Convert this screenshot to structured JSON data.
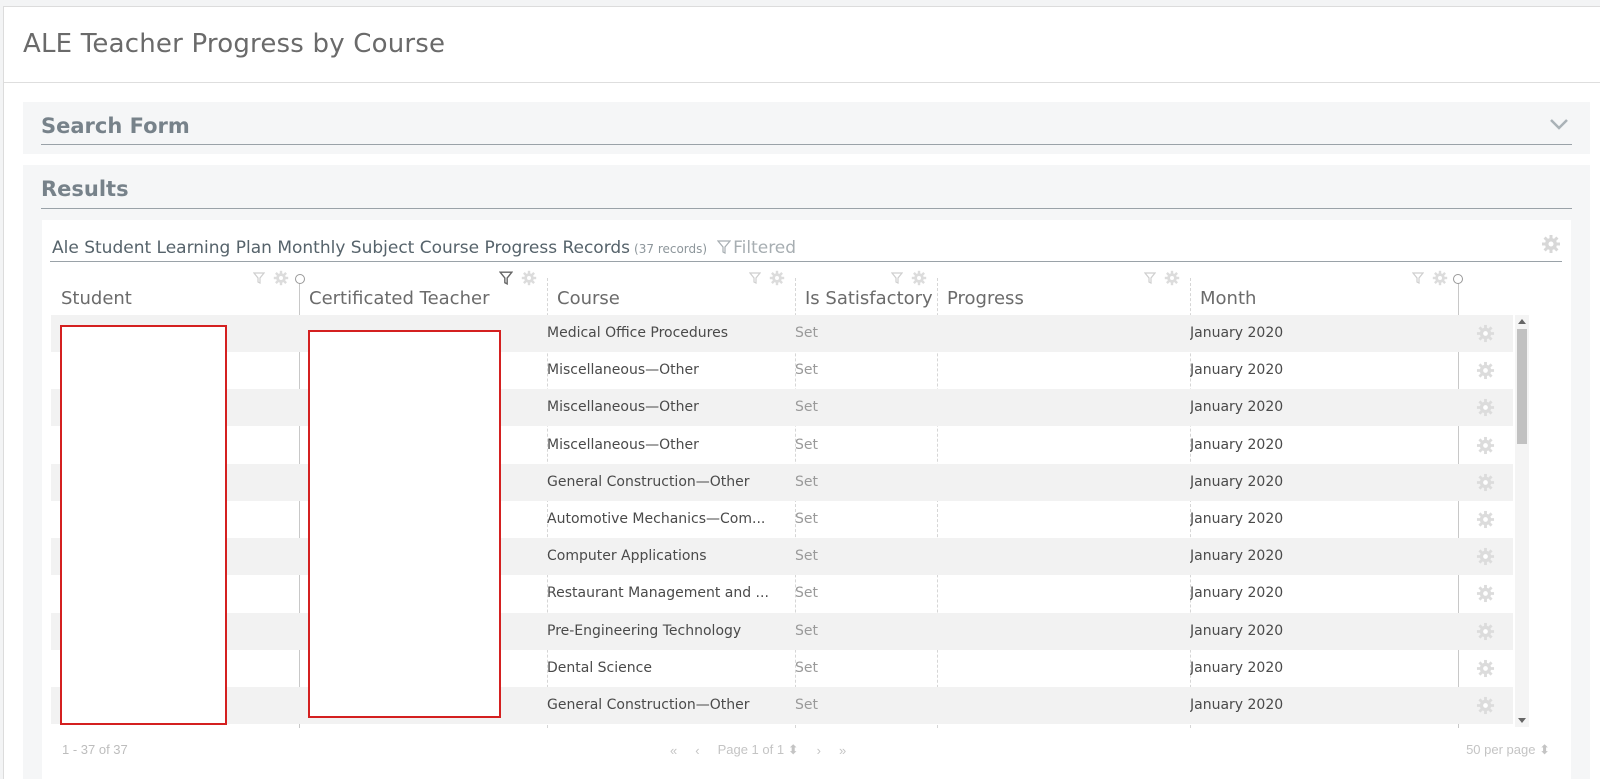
{
  "page": {
    "title": "ALE Teacher Progress by Course"
  },
  "search_form": {
    "title": "Search Form",
    "toggle_icon": "chevron-down-icon"
  },
  "results": {
    "title": "Results",
    "grid": {
      "caption": "Ale Student Learning Plan Monthly Subject Course Progress Records",
      "record_count": "(37 records)",
      "filtered_label": "Filtered",
      "columns": [
        {
          "key": "student",
          "label": "Student"
        },
        {
          "key": "teacher",
          "label": "Certificated Teacher"
        },
        {
          "key": "course",
          "label": "Course"
        },
        {
          "key": "satisfactory",
          "label": "Is Satisfactory"
        },
        {
          "key": "progress",
          "label": "Progress"
        },
        {
          "key": "month",
          "label": "Month"
        }
      ],
      "rows": [
        {
          "course": "Medical Office Procedures",
          "satisfactory": "Set",
          "progress": "",
          "month": "January 2020"
        },
        {
          "course": "Miscellaneous—Other",
          "satisfactory": "Set",
          "progress": "",
          "month": "January 2020"
        },
        {
          "course": "Miscellaneous—Other",
          "satisfactory": "Set",
          "progress": "",
          "month": "January 2020"
        },
        {
          "course": "Miscellaneous—Other",
          "satisfactory": "Set",
          "progress": "",
          "month": "January 2020"
        },
        {
          "course": "General Construction—Other",
          "satisfactory": "Set",
          "progress": "",
          "month": "January 2020"
        },
        {
          "course": "Automotive Mechanics—Com...",
          "satisfactory": "Set",
          "progress": "",
          "month": "January 2020"
        },
        {
          "course": "Computer Applications",
          "satisfactory": "Set",
          "progress": "",
          "month": "January 2020"
        },
        {
          "course": "Restaurant Management and ...",
          "satisfactory": "Set",
          "progress": "",
          "month": "January 2020"
        },
        {
          "course": "Pre-Engineering Technology",
          "satisfactory": "Set",
          "progress": "",
          "month": "January 2020"
        },
        {
          "course": "Dental Science",
          "satisfactory": "Set",
          "progress": "",
          "month": "January 2020"
        },
        {
          "course": "General Construction—Other",
          "satisfactory": "Set",
          "progress": "",
          "month": "January 2020"
        }
      ],
      "footer": {
        "range": "1 - 37 of 37",
        "page_label": "Page 1 of 1",
        "per_page": "50 per page"
      }
    }
  },
  "colors": {
    "redaction_border": "#d42020",
    "panel_bg": "#f5f6f7"
  }
}
